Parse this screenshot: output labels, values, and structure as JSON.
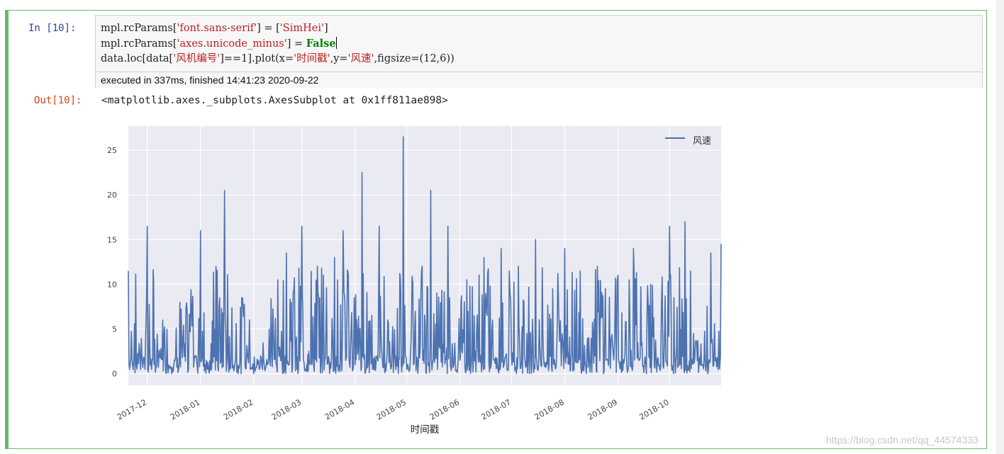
{
  "input_prompt": "In  [10]:",
  "output_prompt": "Out[10]:",
  "code_lines": [
    {
      "a": "mpl.rcParams[",
      "s": "'font.sans-serif'",
      "b": "] = [",
      "s2": "'SimHei'",
      "c": "]"
    },
    {
      "a": "mpl.rcParams[",
      "s": "'axes.unicode_minus'",
      "b": "] = ",
      "k": "False"
    },
    {
      "a": "data.loc[data[",
      "s": "'风机编号'",
      "b": "]==1].plot(x=",
      "s2": "'时间戳'",
      "c": ",y=",
      "s3": "'风速'",
      "d": ",figsize=(12,6))"
    }
  ],
  "execution_info": "executed in 337ms, finished 14:41:23 2020-09-22",
  "output_text": "<matplotlib.axes._subplots.AxesSubplot at 0x1ff811ae898>",
  "watermark": "https://blog.csdn.net/qq_44574333",
  "chart_data": {
    "type": "line",
    "xlabel": "时间戳",
    "ylabel": "",
    "ylim": [
      -1.3,
      27.7
    ],
    "yticks": [
      0,
      5,
      10,
      15,
      20,
      25
    ],
    "xticks": [
      "2017-12",
      "2018-01",
      "2018-02",
      "2018-03",
      "2018-04",
      "2018-05",
      "2018-06",
      "2018-07",
      "2018-08",
      "2018-09",
      "2018-10"
    ],
    "legend_position": "top-right",
    "grid": true,
    "series": [
      {
        "name": "风速",
        "color": "#4c72b0",
        "x": [
          "2017-11-20",
          "2017-11-25",
          "2017-12-01",
          "2017-12-05",
          "2017-12-10",
          "2017-12-15",
          "2017-12-20",
          "2017-12-25",
          "2018-01-01",
          "2018-01-05",
          "2018-01-10",
          "2018-01-15",
          "2018-01-20",
          "2018-01-25",
          "2018-02-01",
          "2018-02-05",
          "2018-02-10",
          "2018-02-15",
          "2018-02-20",
          "2018-02-25",
          "2018-03-01",
          "2018-03-05",
          "2018-03-10",
          "2018-03-15",
          "2018-03-20",
          "2018-03-25",
          "2018-04-01",
          "2018-04-05",
          "2018-04-10",
          "2018-04-15",
          "2018-04-20",
          "2018-04-25",
          "2018-04-29",
          "2018-05-05",
          "2018-05-10",
          "2018-05-15",
          "2018-05-20",
          "2018-05-25",
          "2018-06-01",
          "2018-06-05",
          "2018-06-10",
          "2018-06-15",
          "2018-06-20",
          "2018-06-25",
          "2018-07-01",
          "2018-07-05",
          "2018-07-10",
          "2018-07-15",
          "2018-07-20",
          "2018-07-25",
          "2018-08-01",
          "2018-08-05",
          "2018-08-10",
          "2018-08-15",
          "2018-08-20",
          "2018-08-25",
          "2018-09-01",
          "2018-09-05",
          "2018-09-10",
          "2018-09-15",
          "2018-09-20",
          "2018-09-25",
          "2018-10-01",
          "2018-10-05",
          "2018-10-10",
          "2018-10-15",
          "2018-10-20",
          "2018-10-25",
          "2018-10-31"
        ],
        "values": [
          11.5,
          0.5,
          16.5,
          1.0,
          6.0,
          0.5,
          8.0,
          0.5,
          16.0,
          0.5,
          12.0,
          20.5,
          1.0,
          8.5,
          0.0,
          2.0,
          5.0,
          10.5,
          13.5,
          4.0,
          16.5,
          2.5,
          12.0,
          5.0,
          13.0,
          16.0,
          1.0,
          22.5,
          3.0,
          16.5,
          6.0,
          2.0,
          26.5,
          1.0,
          12.0,
          20.5,
          3.0,
          16.5,
          1.5,
          10.5,
          2.5,
          13.0,
          6.0,
          14.0,
          2.0,
          12.0,
          4.5,
          15.0,
          1.0,
          9.5,
          14.0,
          2.0,
          11.5,
          4.0,
          12.0,
          1.5,
          11.0,
          2.0,
          14.0,
          3.5,
          10.0,
          1.0,
          16.5,
          2.0,
          17.0,
          4.5,
          1.0,
          13.5,
          14.5
        ]
      }
    ]
  }
}
